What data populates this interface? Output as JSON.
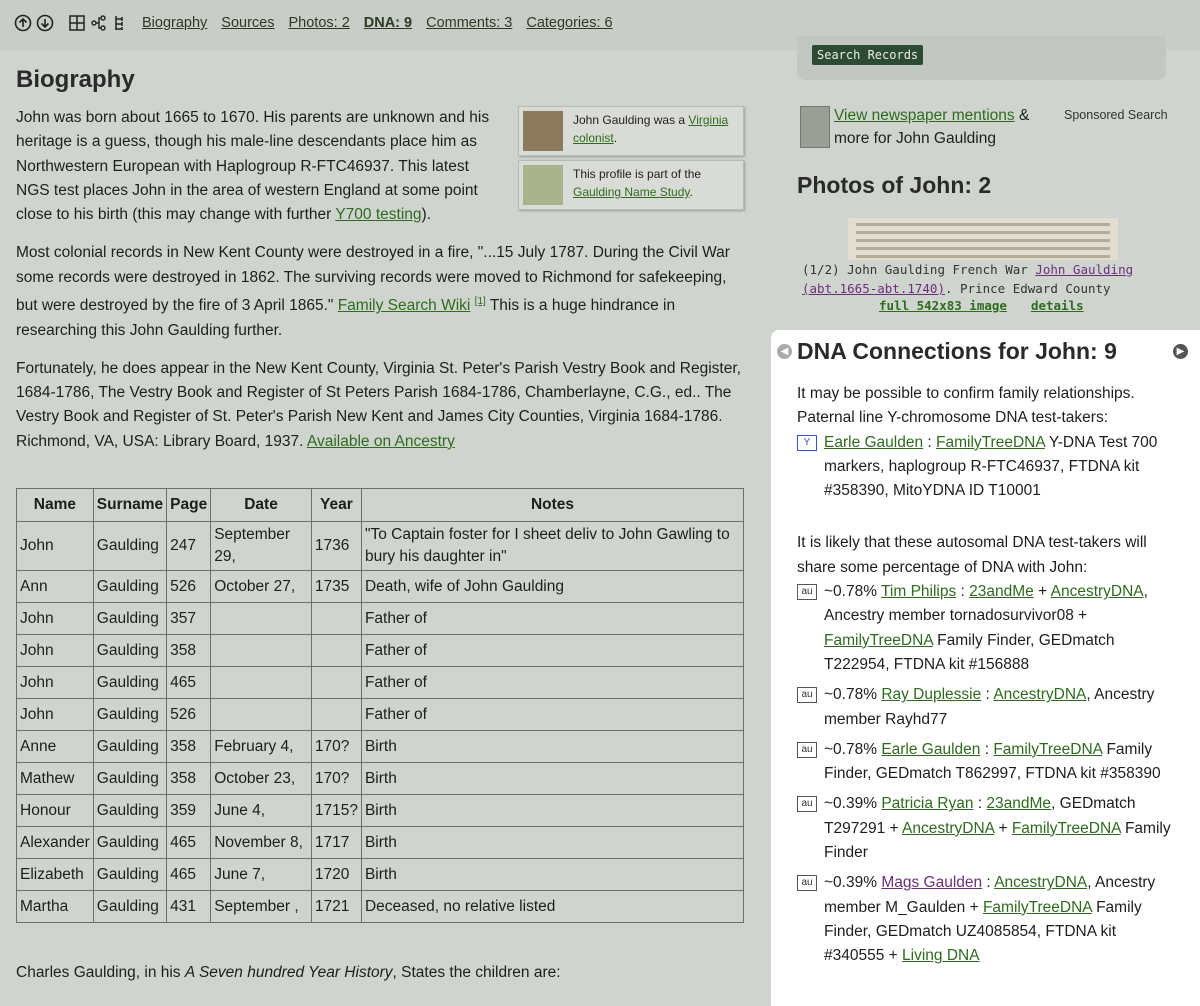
{
  "nav": {
    "links": [
      "Biography",
      "Sources",
      "Photos: 2",
      "DNA: 9",
      "Comments: 3",
      "Categories: 6"
    ],
    "icons": [
      "arrow-up-circle-icon",
      "arrow-down-circle-icon",
      "grid-icon",
      "tree-diagram-icon",
      "hierarchy-icon"
    ]
  },
  "search": {
    "button_label": "Search Records"
  },
  "news": {
    "link_text": "View newspaper mentions",
    "after": " & more for John Gaulding",
    "sponsored": "Sponsored Search"
  },
  "bio": {
    "title": "Biography",
    "box1_text": "John Gaulding was a ",
    "box1_link": "Virginia colonist",
    "box1_end": ".",
    "box2_text": "This profile is part of the ",
    "box2_link": "Gaulding Name Study",
    "box2_end": ".",
    "p1": "John was born about 1665 to 1670. His parents are unknown and his heritage is a guess, though his male-line descendants place him as Northwestern European with Haplogroup R-FTC46937. This latest NGS test places John in the area of western England at some point close to his birth (this may change with further ",
    "p1_link": "Y700 testing",
    "p1_end": ").",
    "p2": "Most colonial records in New Kent County were destroyed in a fire, \"...15 July 1787. During the Civil War some records were destroyed in 1862. The surviving records were moved to Richmond for safekeeping, but were destroyed by the fire of 3 April 1865.\" ",
    "p2_link": "Family Search Wiki",
    "p2_sup": "[1]",
    "p2_end": " This is a huge hindrance in researching this John Gaulding further.",
    "p3": "Fortunately, he does appear in the New Kent County, Virginia St. Peter's Parish Vestry Book and Register, 1684-1786, The Vestry Book and Register of St Peters Parish 1684-1786, Chamberlayne, C.G., ed.. The Vestry Book and Register of St. Peter's Parish New Kent and James City Counties, Virginia 1684-1786. Richmond, VA, USA: Library Board, 1937. ",
    "p3_link": "Available on Ancestry",
    "after_pre": "Charles Gaulding, in his ",
    "after_em": "A Seven hundred Year History",
    "after_post": ", States the children are:"
  },
  "table": {
    "headers": [
      "Name",
      "Surname",
      "Page",
      "Date",
      "Year",
      "Notes"
    ],
    "rows": [
      [
        "John",
        "Gaulding",
        "247",
        "September 29,",
        "1736",
        "\"To Captain foster for I sheet deliv to John Gawling to bury his daughter in\""
      ],
      [
        "Ann",
        "Gaulding",
        "526",
        "October 27,",
        "1735",
        "Death, wife of John Gaulding"
      ],
      [
        "John",
        "Gaulding",
        "357",
        "",
        "",
        "Father of"
      ],
      [
        "John",
        "Gaulding",
        "358",
        "",
        "",
        "Father of"
      ],
      [
        "John",
        "Gaulding",
        "465",
        "",
        "",
        "Father of"
      ],
      [
        "John",
        "Gaulding",
        "526",
        "",
        "",
        "Father of"
      ],
      [
        "Anne",
        "Gaulding",
        "358",
        "February 4,",
        "170?",
        "Birth"
      ],
      [
        "Mathew",
        "Gaulding",
        "358",
        "October 23,",
        "170?",
        "Birth"
      ],
      [
        "Honour",
        "Gaulding",
        "359",
        "June 4,",
        "1715?",
        "Birth"
      ],
      [
        "Alexander",
        "Gaulding",
        "465",
        "November 8,",
        "1717",
        "Birth"
      ],
      [
        "Elizabeth",
        "Gaulding",
        "465",
        "June 7,",
        "1720",
        "Birth"
      ],
      [
        "Martha",
        "Gaulding",
        "431",
        "September ,",
        "1721",
        "Deceased, no relative listed"
      ]
    ]
  },
  "photos": {
    "title": "Photos of John: 2",
    "caption_pre": "(1/2) John Gaulding French War ",
    "caption_link": "John Gaulding (abt.1665-abt.1740)",
    "caption_post": ". Prince Edward County",
    "full_link": "full 542x83 image",
    "details_link": "details"
  },
  "dna": {
    "title": "DNA Connections for John: 9",
    "intro1": "It may be possible to confirm family relationships. Paternal line Y-chromosome DNA test-takers:",
    "y_entry": {
      "badge": "Y",
      "name": "Earle Gaulden",
      "sep": " : ",
      "company": "FamilyTreeDNA",
      "rest": " Y-DNA Test 700 markers, haplogroup R-FTC46937, FTDNA kit #358390, MitoYDNA ID T10001"
    },
    "intro2": "It is likely that these autosomal DNA test-takers will share some percentage of DNA with John:",
    "au_badge": "au",
    "entries": [
      {
        "pct": "~0.78% ",
        "name": "Tim Philips",
        "sep": " : ",
        "c1": "23andMe",
        "m1": " + ",
        "c2": "AncestryDNA",
        "m2": ", Ancestry member tornadosurvivor08 + ",
        "c3": "FamilyTreeDNA",
        "m3": " Family Finder, GEDmatch T222954, FTDNA kit #156888",
        "c4": "",
        "m4": ""
      },
      {
        "pct": "~0.78% ",
        "name": "Ray Duplessie",
        "sep": " : ",
        "c1": "AncestryDNA",
        "m1": ", Ancestry member Rayhd77",
        "c2": "",
        "m2": "",
        "c3": "",
        "m3": "",
        "c4": "",
        "m4": ""
      },
      {
        "pct": "~0.78% ",
        "name": "Earle Gaulden",
        "sep": " : ",
        "c1": "FamilyTreeDNA",
        "m1": " Family Finder, GEDmatch T862997, FTDNA kit #358390",
        "c2": "",
        "m2": "",
        "c3": "",
        "m3": "",
        "c4": "",
        "m4": ""
      },
      {
        "pct": "~0.39% ",
        "name": "Patricia Ryan",
        "sep": " : ",
        "c1": "23andMe",
        "m1": ", GEDmatch T297291 + ",
        "c2": "AncestryDNA",
        "m2": " + ",
        "c3": "FamilyTreeDNA",
        "m3": " Family Finder",
        "c4": "",
        "m4": ""
      },
      {
        "pct": "~0.39% ",
        "name": "Mags Gaulden",
        "sep": " : ",
        "c1": "AncestryDNA",
        "m1": ", Ancestry member M_Gaulden + ",
        "c2": "FamilyTreeDNA",
        "m2": " Family Finder, GEDmatch UZ4085854, FTDNA kit #340555 + ",
        "c3": "Living DNA",
        "m3": "",
        "c4": "",
        "m4": ""
      }
    ]
  }
}
